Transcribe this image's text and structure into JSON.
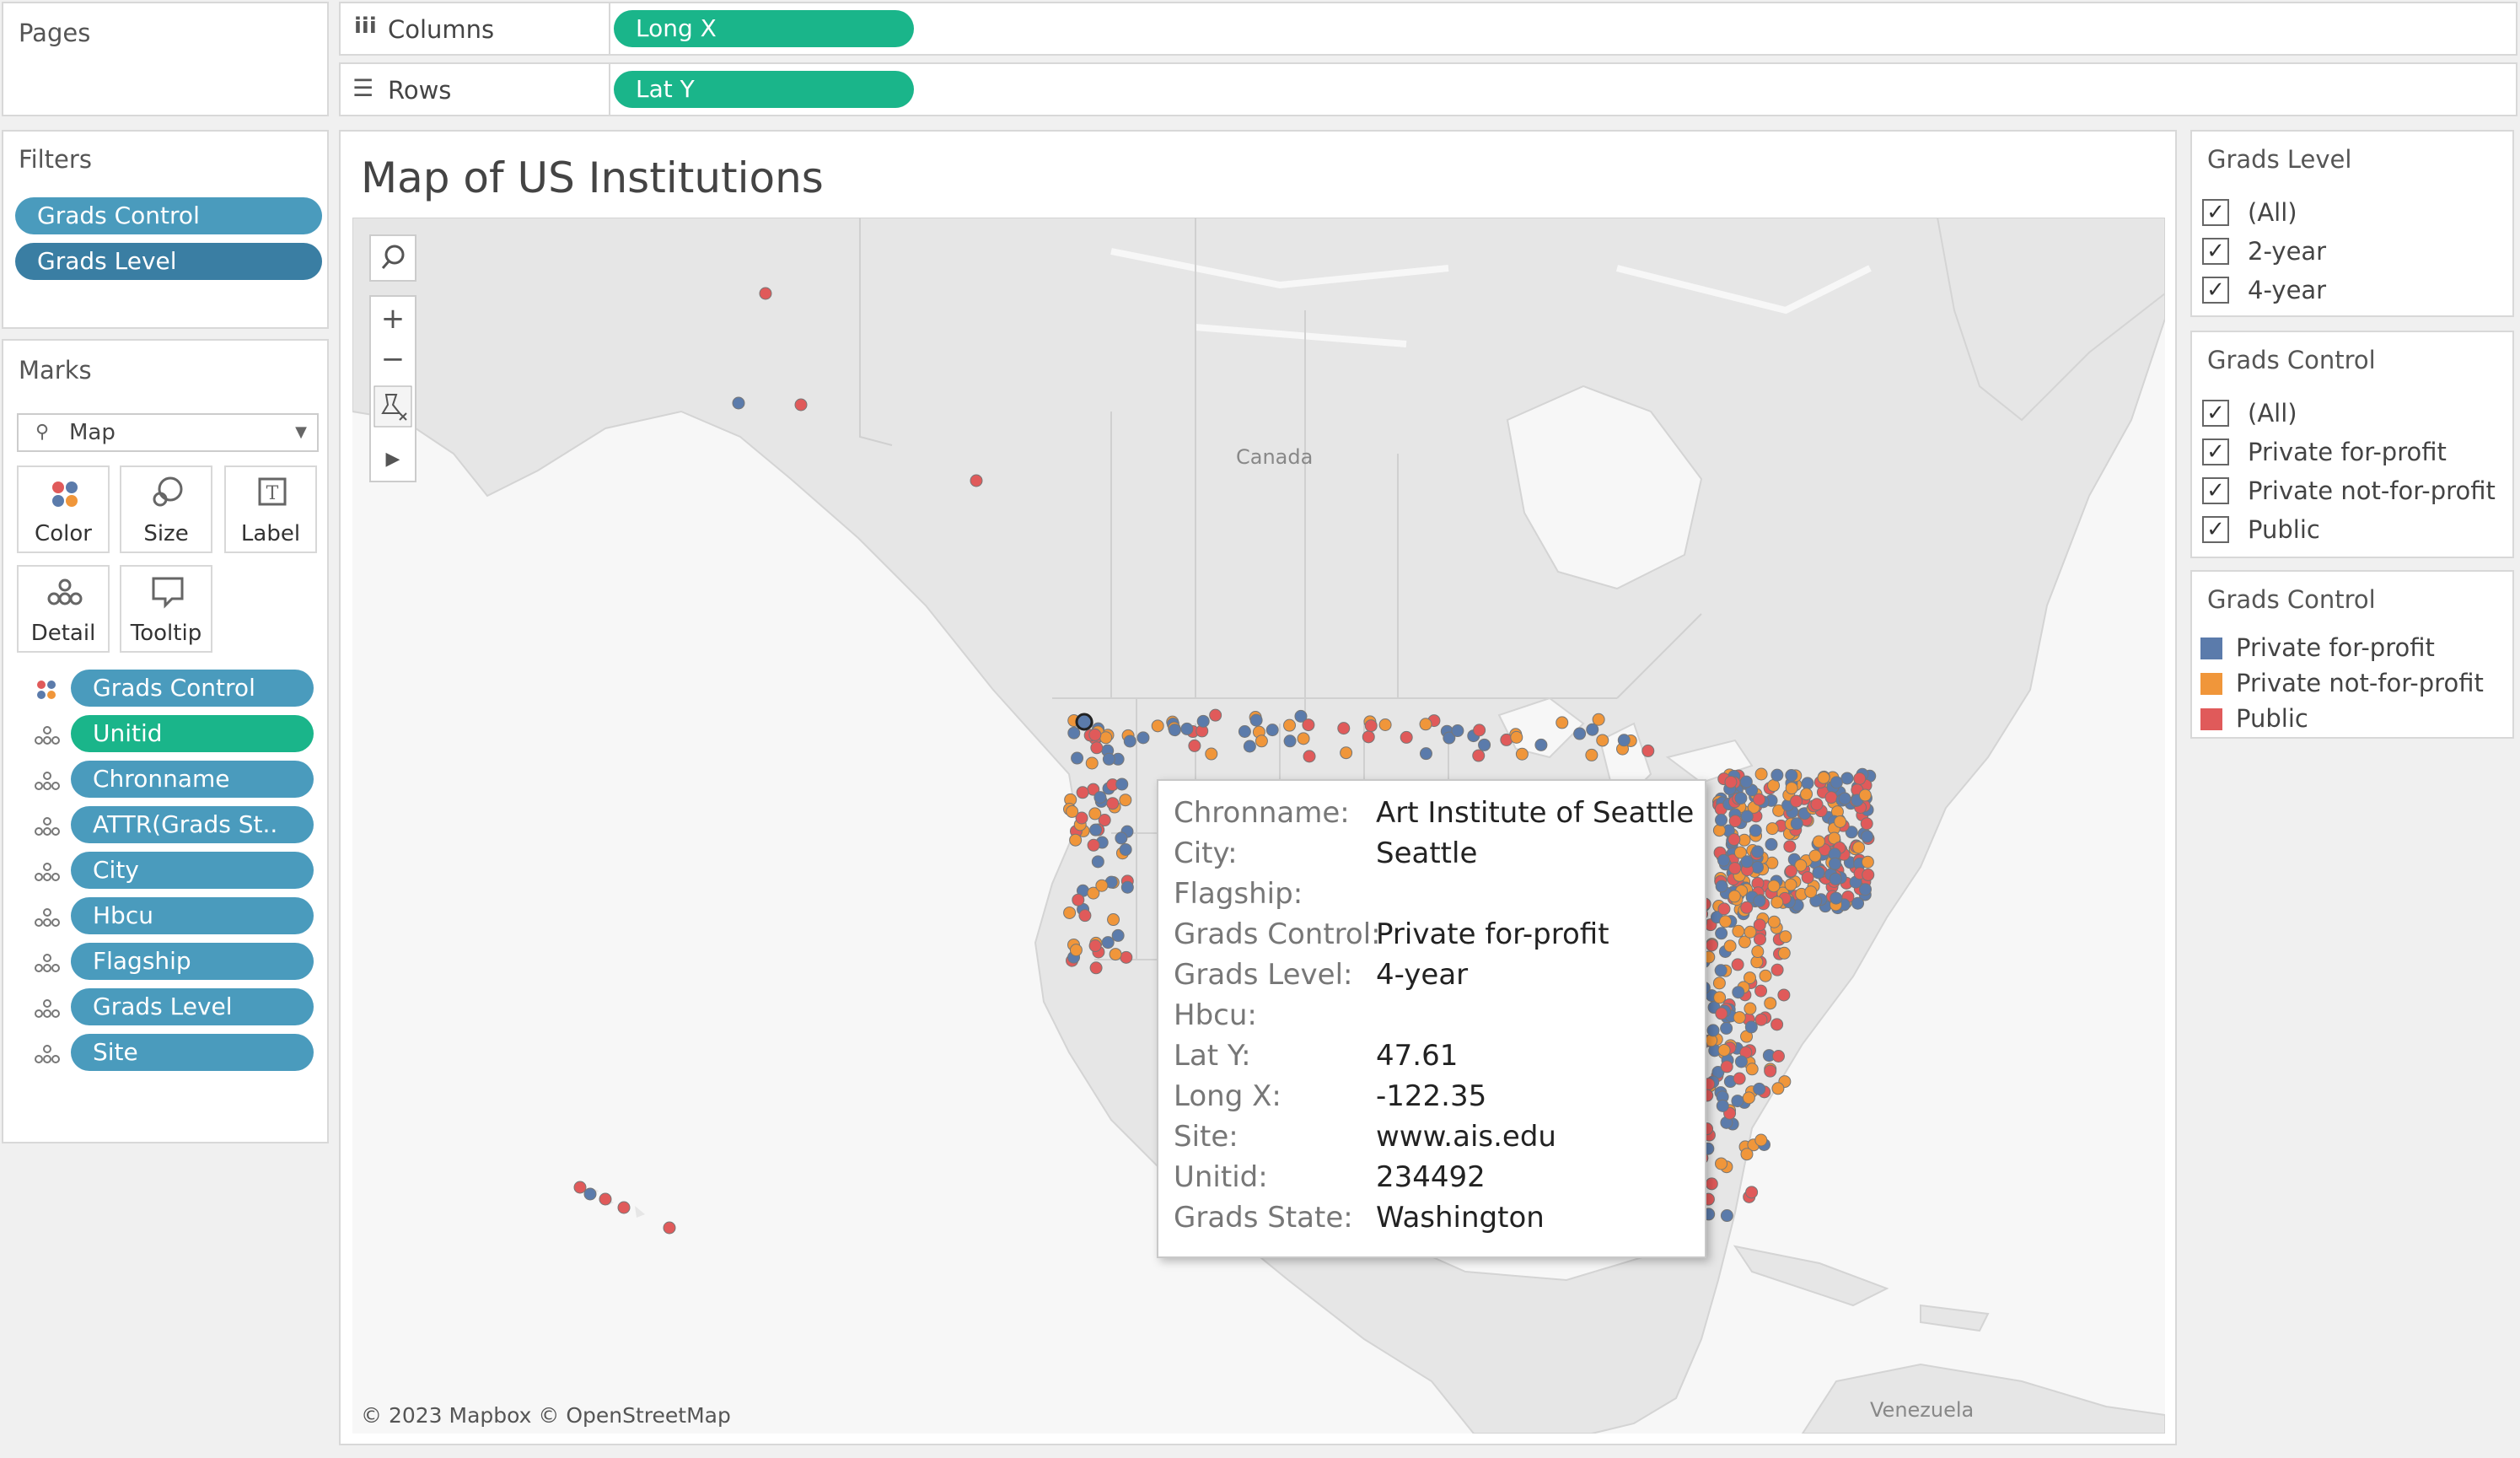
{
  "pages": {
    "title": "Pages"
  },
  "shelves": {
    "columns": {
      "label": "Columns",
      "pill": "Long X"
    },
    "rows": {
      "label": "Rows",
      "pill": "Lat Y"
    }
  },
  "filters": {
    "title": "Filters",
    "items": [
      "Grads Control",
      "Grads Level"
    ]
  },
  "marks": {
    "title": "Marks",
    "type": "Map",
    "cards": {
      "color": "Color",
      "size": "Size",
      "label": "Label",
      "detail": "Detail",
      "tooltip": "Tooltip"
    },
    "fields": [
      "Grads Control",
      "Unitid",
      "Chronname",
      "ATTR(Grads St..",
      "City",
      "Hbcu",
      "Flagship",
      "Grads Level",
      "Site"
    ]
  },
  "view": {
    "title": "Map of US Institutions",
    "attribution": "© 2023 Mapbox © OpenStreetMap",
    "labels": {
      "canada": "Canada",
      "venezuela": "Venezuela"
    }
  },
  "tooltip": {
    "rows": [
      {
        "k": "Chronname:",
        "v": "Art Institute of Seattle"
      },
      {
        "k": "City:",
        "v": "Seattle"
      },
      {
        "k": "Flagship:",
        "v": ""
      },
      {
        "k": "Grads Control:",
        "v": "Private for-profit"
      },
      {
        "k": "Grads Level:",
        "v": "4-year"
      },
      {
        "k": "Hbcu:",
        "v": ""
      },
      {
        "k": "Lat Y:",
        "v": "47.61"
      },
      {
        "k": "Long X:",
        "v": "-122.35"
      },
      {
        "k": "Site:",
        "v": "www.ais.edu"
      },
      {
        "k": "Unitid:",
        "v": "234492"
      },
      {
        "k": "Grads State:",
        "v": "Washington"
      }
    ]
  },
  "grads_level_filter": {
    "title": "Grads Level",
    "options": [
      "(All)",
      "2-year",
      "4-year"
    ],
    "check": "✓"
  },
  "grads_control_filter": {
    "title": "Grads Control",
    "options": [
      "(All)",
      "Private for-profit",
      "Private not-for-profit",
      "Public"
    ],
    "check": "✓"
  },
  "legend": {
    "title": "Grads Control",
    "items": [
      {
        "label": "Private for-profit",
        "color": "#5b7bab"
      },
      {
        "label": "Private not-for-profit",
        "color": "#f0963a"
      },
      {
        "label": "Public",
        "color": "#e05a5a"
      }
    ]
  }
}
